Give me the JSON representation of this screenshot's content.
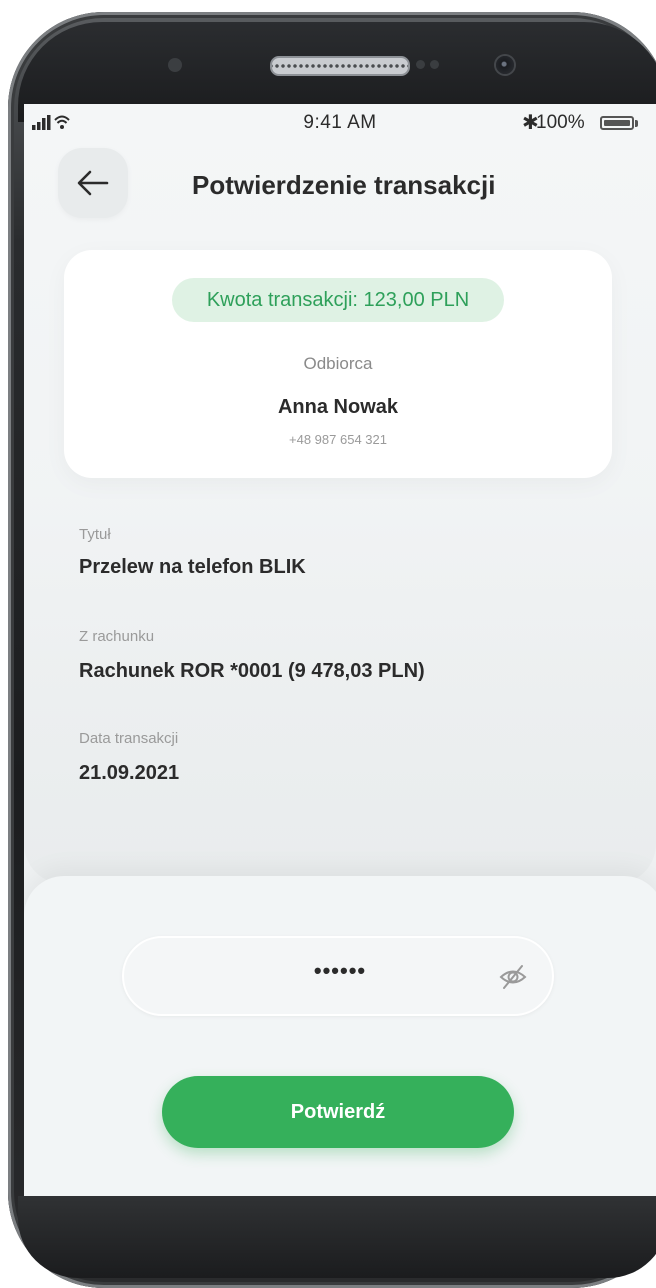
{
  "status_bar": {
    "time": "9:41 AM",
    "battery": "100%",
    "bluetooth_icon": "bluetooth-icon",
    "signal_icon": "signal-icon",
    "wifi_icon": "wifi-icon",
    "battery_level": 1.0
  },
  "header": {
    "title": "Potwierdzenie transakcji",
    "back_icon": "arrow-left-icon"
  },
  "summary": {
    "amount_text": "Kwota transakcji: 123,00 PLN",
    "recipient_label": "Odbiorca",
    "recipient_name": "Anna Nowak",
    "recipient_phone": "+48 987 654 321"
  },
  "details": [
    {
      "label": "Tytuł",
      "value": "Przelew na telefon BLIK"
    },
    {
      "label": "Z rachunku",
      "value": "Rachunek ROR *0001 (9 478,03 PLN)"
    },
    {
      "label": "Data transakcji",
      "value": "21.09.2021"
    }
  ],
  "password": {
    "value": "••••••",
    "toggle_icon": "eye-off-icon"
  },
  "confirm_label": "Potwierdź",
  "colors": {
    "accent_green": "#35b05b",
    "pill_bg": "#dff2e4",
    "pill_text": "#2ea05a"
  }
}
